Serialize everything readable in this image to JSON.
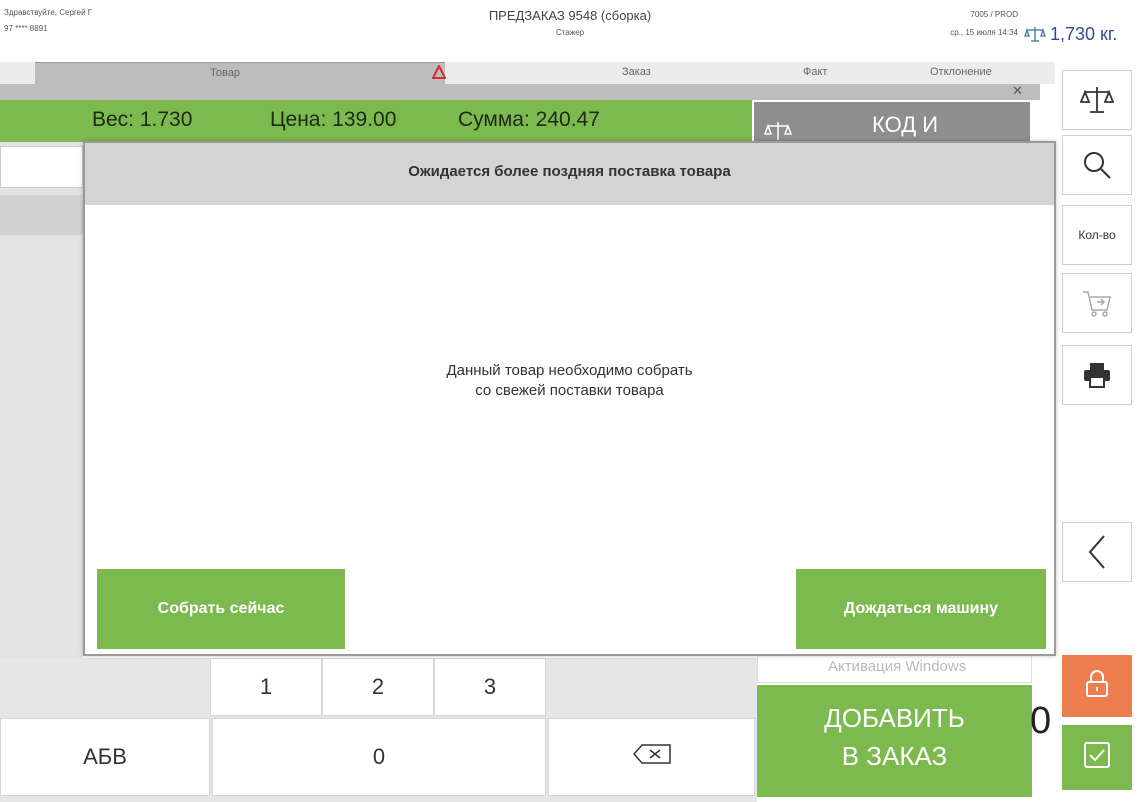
{
  "header": {
    "greeting": "Здравствуйте, Сергей Г",
    "phone": "97 **** 8891",
    "order_title": "ПРЕДЗАКАЗ 9548 (сборка)",
    "role": "Стажер",
    "store": "7005 / PROD",
    "datetime": "ср., 15 июля 14:34",
    "scale_weight": "1,730 кг."
  },
  "table_header": {
    "goods": "Товар",
    "order": "Заказ",
    "fact": "Факт",
    "deviation": "Отклонение"
  },
  "info_bar": {
    "weight": "Вес: 1.730",
    "price": "Цена: 139.00",
    "sum": "Сумма: 240.47"
  },
  "code_button": "КОД И",
  "sidebar": {
    "qty_label": "Кол-во"
  },
  "keypad": {
    "k1": "1",
    "k2": "2",
    "k3": "3",
    "k0": "0",
    "abc": "АБВ"
  },
  "add_button": {
    "line1": "ДОБАВИТЬ",
    "line2": "В ЗАКАЗ"
  },
  "activation": "Активация Windows",
  "quantity_value": "0",
  "modal": {
    "title": "Ожидается более поздняя поставка товара",
    "message_line1": "Данный товар необходимо собрать",
    "message_line2": "со свежей поставки товара",
    "collect_now": "Собрать сейчас",
    "wait_truck": "Дождаться машину"
  },
  "colors": {
    "accent_green": "#7cb94f",
    "lock_orange": "#ee7d4f",
    "warning_red": "#d32f2f"
  }
}
